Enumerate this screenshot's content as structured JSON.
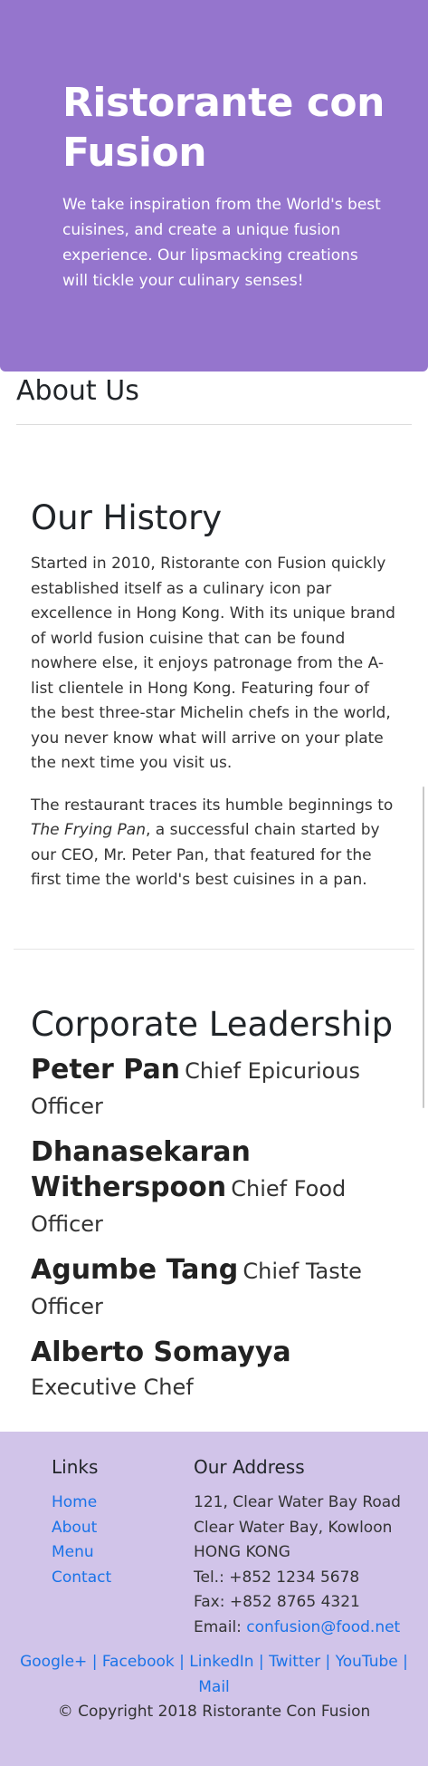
{
  "jumbotron": {
    "title": "Ristorante con Fusion",
    "tagline": "We take inspiration from the World's best cuisines, and create a unique fusion experience. Our lipsmacking creations will tickle your culinary senses!"
  },
  "about": {
    "heading": "About Us"
  },
  "history": {
    "heading": "Our History",
    "para1": "Started in 2010, Ristorante con Fusion quickly established itself as a culinary icon par excellence in Hong Kong. With its unique brand of world fusion cuisine that can be found nowhere else, it enjoys patronage from the A-list clientele in Hong Kong. Featuring four of the best three-star Michelin chefs in the world, you never know what will arrive on your plate the next time you visit us.",
    "para2_prefix": "The restaurant traces its humble beginnings to ",
    "para2_italic": "The Frying Pan",
    "para2_suffix": ", a successful chain started by our CEO, Mr. Peter Pan, that featured for the first time the world's best cuisines in a pan."
  },
  "leadership": {
    "heading": "Corporate Leadership",
    "leaders": [
      {
        "name": "Peter Pan",
        "role": "Chief Epicurious Officer"
      },
      {
        "name": "Dhanasekaran Witherspoon",
        "role": "Chief Food Officer"
      },
      {
        "name": "Agumbe Tang",
        "role": "Chief Taste Officer"
      },
      {
        "name": "Alberto Somayya",
        "role": "Executive Chef"
      }
    ]
  },
  "footer": {
    "links_heading": "Links",
    "links": [
      "Home",
      "About",
      "Menu",
      "Contact"
    ],
    "address_heading": "Our Address",
    "address_lines": [
      "121, Clear Water Bay Road",
      "Clear Water Bay, Kowloon",
      "HONG KONG",
      "Tel.: +852 1234 5678",
      "Fax: +852 8765 4321"
    ],
    "email_label": "Email: ",
    "email": "confusion@food.net",
    "social": [
      "Google+",
      "Facebook",
      "LinkedIn",
      "Twitter",
      "YouTube",
      "Mail"
    ],
    "copyright": "© Copyright 2018 Ristorante Con Fusion"
  },
  "colors": {
    "jumbotron_bg": "#9575cd",
    "footer_bg": "#d1c4e9",
    "link": "#1a73e8"
  }
}
